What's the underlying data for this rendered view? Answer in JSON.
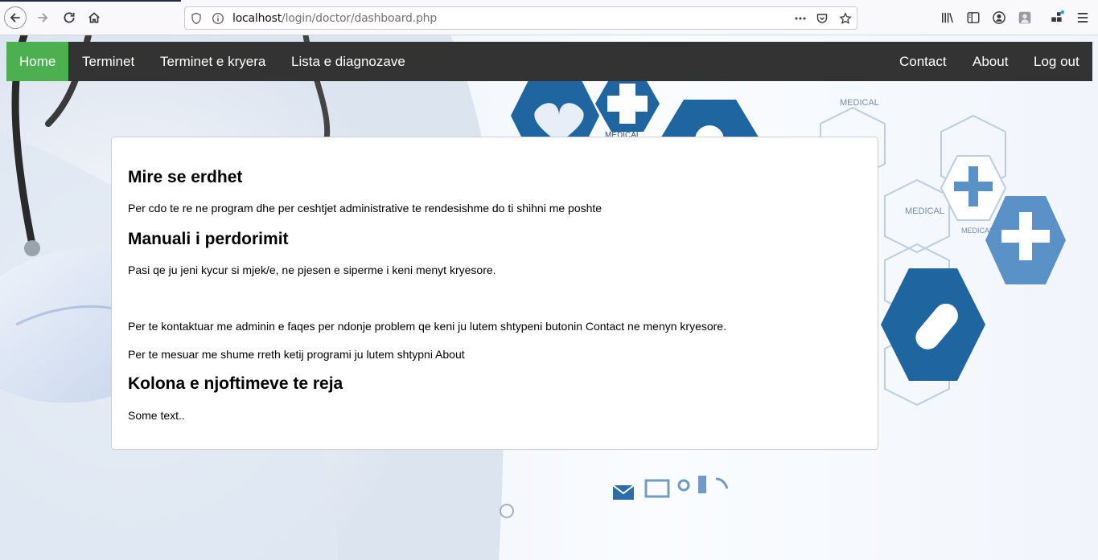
{
  "browser": {
    "url_host": "localhost",
    "url_path": "/login/doctor/dashboard.php"
  },
  "nav": {
    "left": [
      "Home",
      "Terminet",
      "Terminet e kryera",
      "Lista e diagnozave"
    ],
    "right": [
      "Contact",
      "About",
      "Log out"
    ],
    "active": "Home"
  },
  "content": {
    "heading_welcome": "Mire se erdhet",
    "text_welcome": "Per cdo te re ne program dhe per ceshtjet administrative te rendesishme do ti shihni me poshte",
    "heading_manual": "Manuali i perdorimit",
    "text_manual_1": "Pasi qe ju jeni kycur si mjek/e, ne pjesen e siperme i keni menyt kryesore.",
    "text_manual_2": "Per te kontaktuar me adminin e faqes per ndonje problem qe keni ju lutem shtypeni butonin Contact ne menyn kryesore.",
    "text_manual_3": "Per te mesuar me shume rreth ketij programi ju lutem shtypni About",
    "heading_news": "Kolona e njoftimeve te reja",
    "text_news": "Some text.."
  },
  "background_art": {
    "hex_labels": [
      "MEDICAL",
      "MEDICAL",
      "MEDICAL",
      "MEDICAL"
    ]
  },
  "colors": {
    "nav_bg": "#333333",
    "nav_active": "#4caf50",
    "medical_blue": "#1f65a0",
    "medical_light_blue": "#5a92c8"
  }
}
